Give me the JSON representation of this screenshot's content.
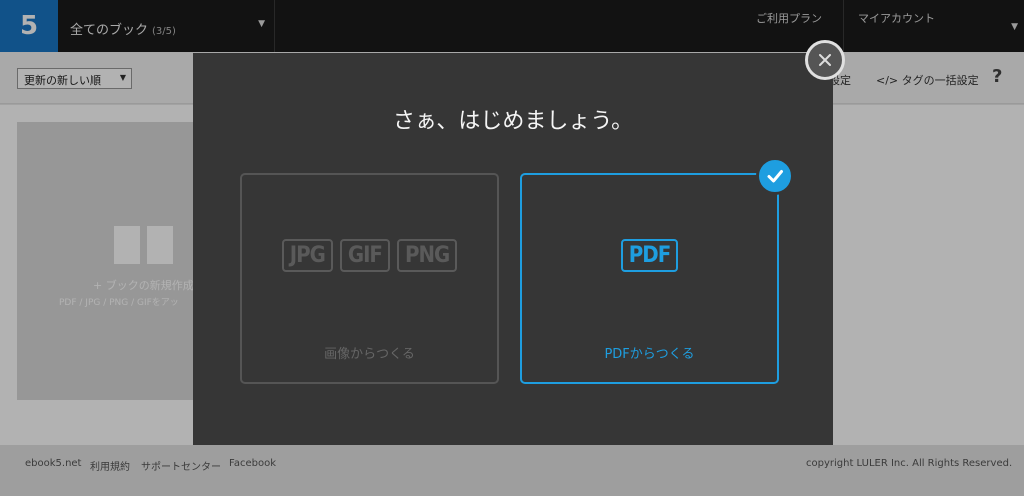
{
  "header": {
    "logo": "5",
    "book_select": {
      "label": "全てのブック",
      "count": "(3/5)"
    },
    "plan_link": "ご利用プラン",
    "account_label": "マイアカウント"
  },
  "toolbar": {
    "sort_select": "更新の新しい順",
    "settings_link": "設定",
    "tag_link": "</> タグの一括設定",
    "help": "?"
  },
  "content": {
    "new_book_label": "+ ブックの新規作成",
    "new_book_sub": "PDF / JPG / PNG / GIFをアッ"
  },
  "footer": {
    "links": [
      "ebook5.net",
      "利用規約",
      "サポートセンター",
      "Facebook"
    ],
    "copyright": "copyright LULER Inc. All Rights Reserved."
  },
  "modal": {
    "title": "さぁ、はじめましょう。",
    "options": [
      {
        "formats": [
          "JPG",
          "GIF",
          "PNG"
        ],
        "label": "画像からつくる",
        "selected": false
      },
      {
        "formats": [
          "PDF"
        ],
        "label": "PDFからつくる",
        "selected": true
      }
    ],
    "accent_color": "#1e9ee0"
  }
}
